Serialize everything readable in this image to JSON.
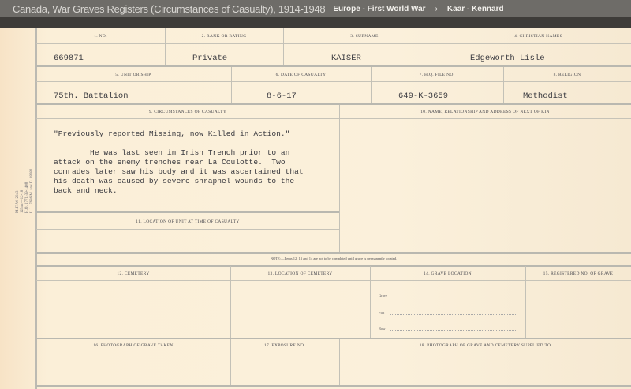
{
  "header": {
    "title": "Canada, War Graves Registers (Circumstances of Casualty), 1914-1948",
    "breadcrumb": [
      "Europe - First World War",
      "Kaar - Kennard"
    ],
    "separator": "›"
  },
  "form": {
    "row1": {
      "labels": [
        "1. NO.",
        "2. RANK OR RATING",
        "3. SURNAME",
        "4. CHRISTIAN NAMES"
      ],
      "values": [
        "669871",
        "Private",
        "KAISER",
        "Edgeworth Lisle"
      ]
    },
    "row2": {
      "labels": [
        "5. UNIT OR SHIP.",
        "6. DATE OF CASUALTY",
        "7. H.Q. FILE NO.",
        "8. RELIGION"
      ],
      "values": [
        "75th. Battalion",
        "8-6-17",
        "649-K-3659",
        "Methodist"
      ]
    },
    "circumstances_label": "9. CIRCUMSTANCES OF CASUALTY",
    "circumstances_text": "\"Previously reported Missing, now Killed in Action.\"\n\n        He was last seen in Irish Trench prior to an\nattack on the enemy trenches near La Coulotte.  Two\ncomrades later saw his body and it was ascertained that\nhis death was caused by severe shrapnel wounds to the\nback and neck.",
    "next_of_kin_label": "10. NAME, RELATIONSHIP AND ADDRESS OF NEXT OF KIN",
    "location_label": "11. LOCATION OF UNIT AT TIME OF CASUALTY",
    "note": "NOTE:—Items 12, 13 and 14 are not to be completed until grave is permanently located.",
    "cemetery_row_labels": [
      "12. CEMETERY",
      "13. LOCATION OF CEMETERY",
      "14. GRAVE LOCATION",
      "15. REGISTERED NO. OF GRAVE"
    ],
    "grave_fields": [
      "Grave",
      "Plot",
      "Row"
    ],
    "photo_row_labels": [
      "16. PHOTOGRAPH OF GRAVE TAKEN",
      "17. EXPOSURE NO.",
      "18. PHOTOGRAPH OF GRAVE AND CEMETERY SUPPLIED TO"
    ],
    "side_print": "M. F. W. 2043\n125m.—12-18\nH.Q. 1771-39-1408\nL. L. 7636 M. and D. 18682"
  }
}
